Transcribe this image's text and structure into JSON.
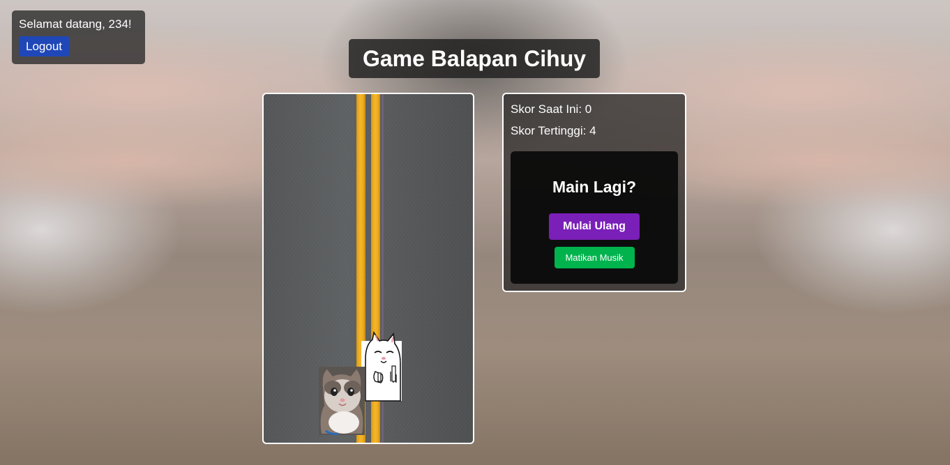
{
  "header": {
    "welcome_text": "Selamat datang, 234!",
    "logout_label": "Logout",
    "title": "Game Balapan Cihuy"
  },
  "scoreboard": {
    "current_score_text": "Skor Saat Ini: 0",
    "high_score_text": "Skor Tertinggi: 4",
    "current_score": 0,
    "high_score": 4
  },
  "game_over": {
    "title": "Main Lagi?",
    "restart_label": "Mulai Ulang",
    "music_label": "Matikan Musik"
  },
  "colors": {
    "logout_button": "#1f47b8",
    "restart_button": "#7a1fb8",
    "music_button": "#00b34d",
    "lane_line": "#f5b62a",
    "road": "#5a5c5e"
  },
  "sprites": {
    "player": "crying-cat-icon",
    "obstacle": "white-cat-middle-finger-icon"
  }
}
